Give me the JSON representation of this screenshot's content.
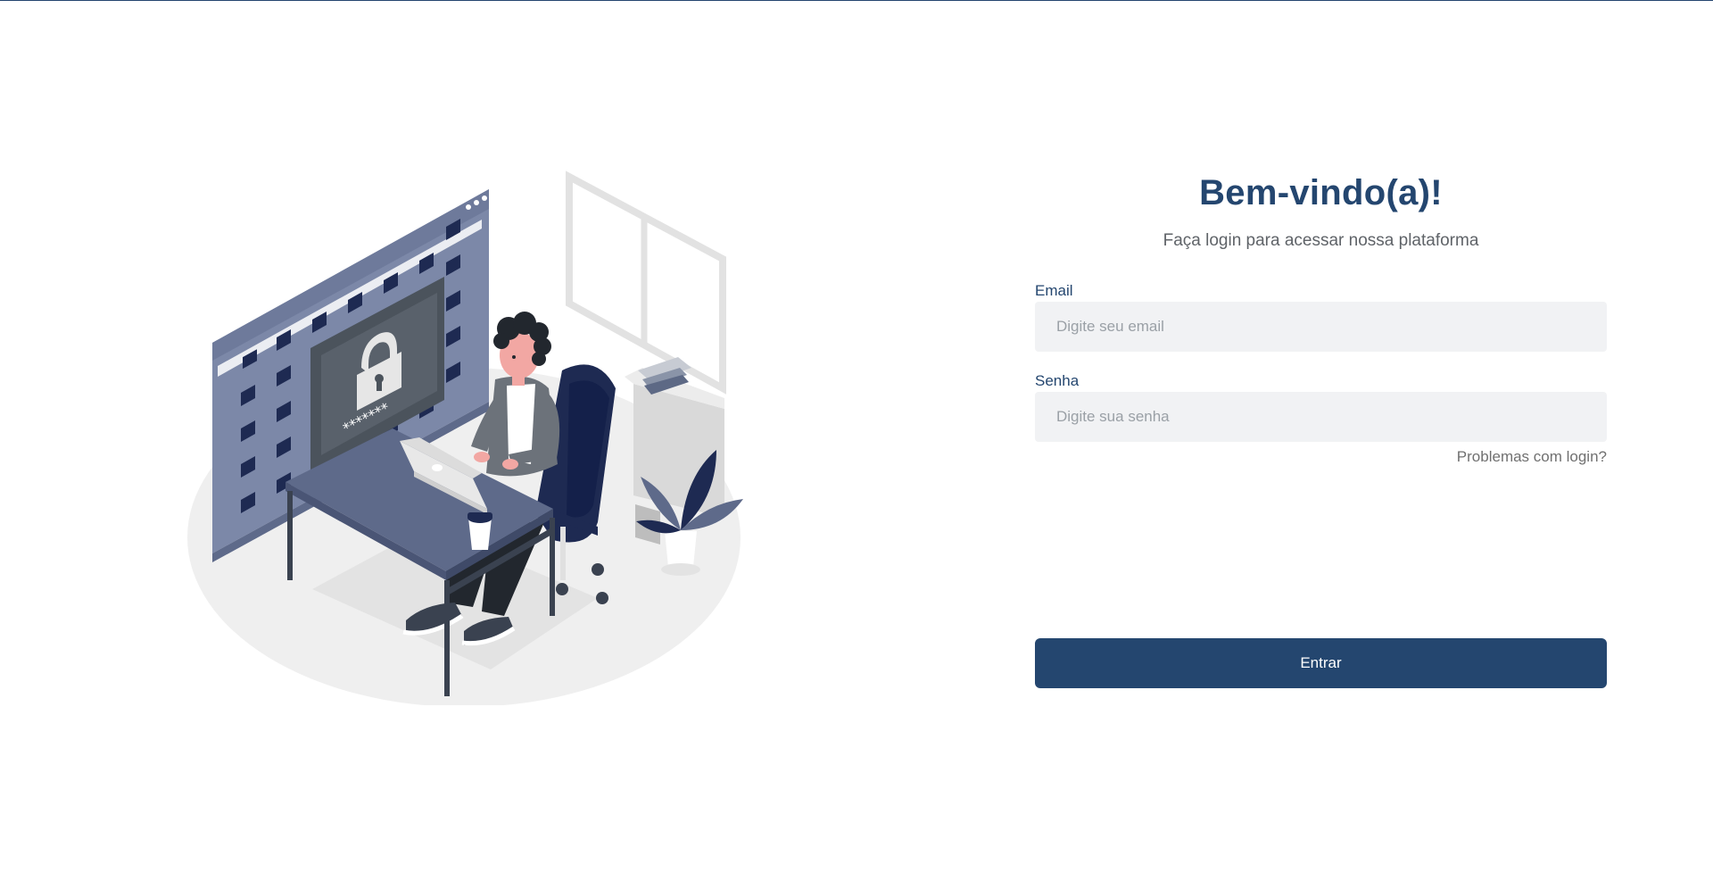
{
  "login": {
    "title": "Bem-vindo(a)!",
    "subtitle": "Faça login para acessar nossa plataforma",
    "email_label": "Email",
    "email_placeholder": "Digite seu email",
    "email_value": "",
    "password_label": "Senha",
    "password_placeholder": "Digite sua senha",
    "password_value": "",
    "forgot_link": "Problemas com login?",
    "submit_label": "Entrar"
  },
  "illustration": {
    "icon": "secure-login-illustration",
    "password_mask": "*******"
  },
  "colors": {
    "brand": "#24466f",
    "input_bg": "#f1f2f4",
    "subtitle": "#5f6368",
    "link": "#707070",
    "illustration_slate": "#7c88a8",
    "illustration_navy": "#1e2a52"
  }
}
